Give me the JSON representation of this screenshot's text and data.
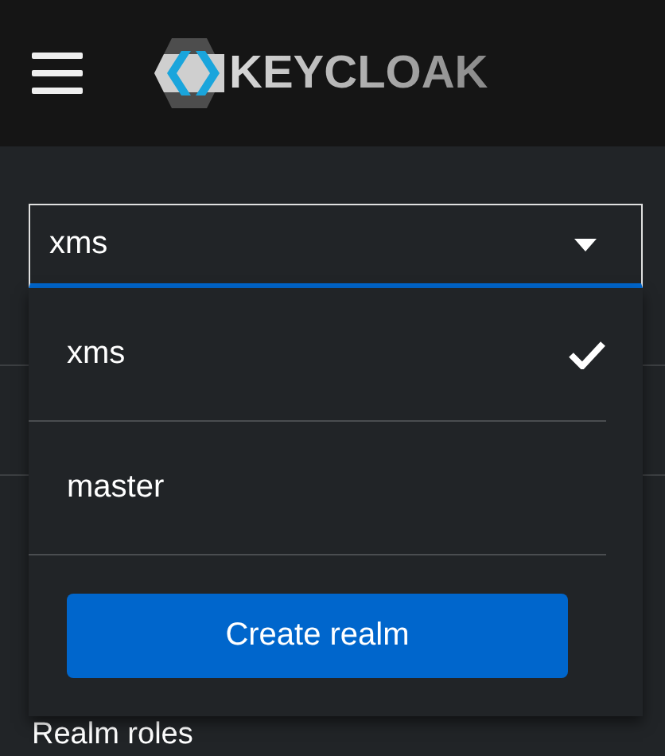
{
  "header": {
    "logo_text": "KEYCLOAK"
  },
  "realm_select": {
    "value": "xms",
    "expanded": true,
    "options": [
      {
        "label": "xms",
        "selected": true
      },
      {
        "label": "master",
        "selected": false
      }
    ],
    "create_button": "Create realm"
  },
  "sidebar": {
    "items": [
      {
        "label": "Realm roles"
      }
    ]
  }
}
